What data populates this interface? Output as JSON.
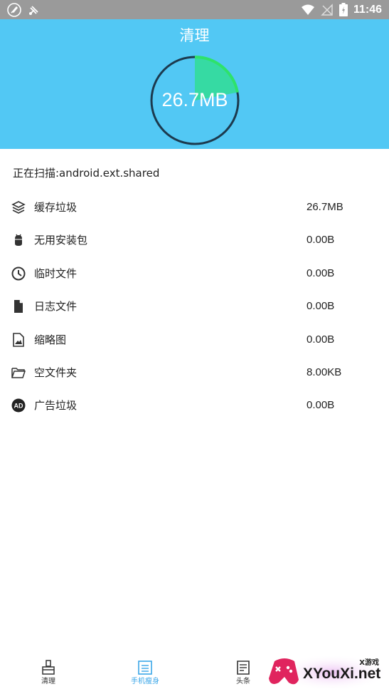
{
  "status_bar": {
    "time": "11:46"
  },
  "header": {
    "title": "清理",
    "gauge_value": "26.7MB",
    "gauge_progress_fraction": 0.22,
    "accent_color": "#2ee26a",
    "background_color": "#52c8f4"
  },
  "scan": {
    "text": "正在扫描:android.ext.shared"
  },
  "items": [
    {
      "icon": "layers-icon",
      "label": "缓存垃圾",
      "size": "26.7MB"
    },
    {
      "icon": "android-icon",
      "label": "无用安装包",
      "size": "0.00B"
    },
    {
      "icon": "clock-icon",
      "label": "临时文件",
      "size": "0.00B"
    },
    {
      "icon": "document-icon",
      "label": "日志文件",
      "size": "0.00B"
    },
    {
      "icon": "image-icon",
      "label": "缩略图",
      "size": "0.00B"
    },
    {
      "icon": "folder-icon",
      "label": "空文件夹",
      "size": "8.00KB"
    },
    {
      "icon": "ad-icon",
      "label": "广告垃圾",
      "size": "0.00B"
    }
  ],
  "bottom_nav": [
    {
      "icon": "broom-icon",
      "label": "清理",
      "active": false
    },
    {
      "icon": "phone-slim-icon",
      "label": "手机瘦身",
      "active": true
    },
    {
      "icon": "news-icon",
      "label": "头条",
      "active": false
    }
  ],
  "watermark": {
    "top": "X游戏",
    "main": "XYouXi.net"
  }
}
